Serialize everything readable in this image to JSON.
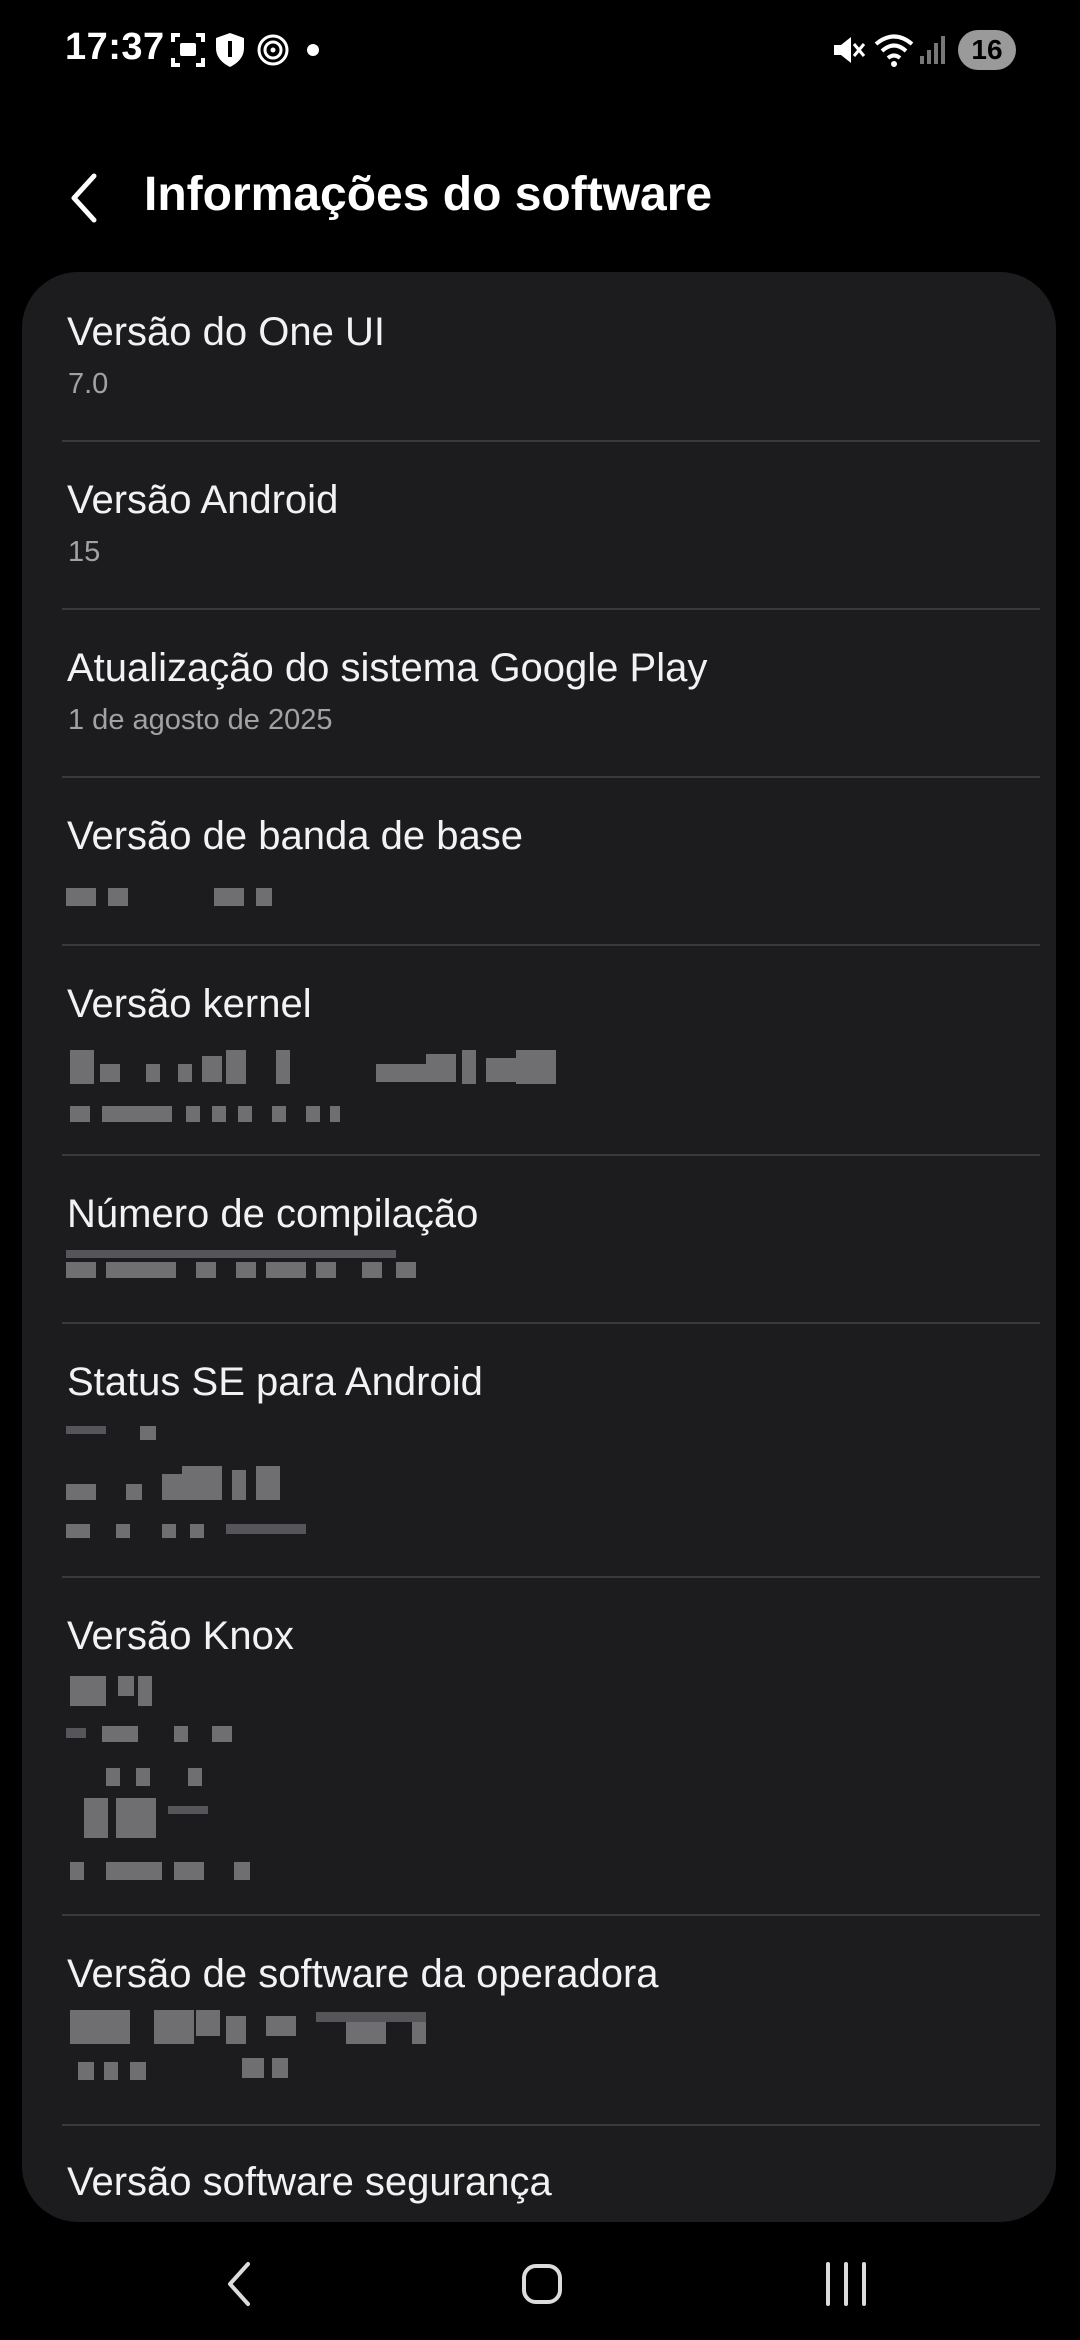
{
  "status_bar": {
    "time": "17:37",
    "left_icons": [
      "screenshot-icon",
      "shield-icon",
      "sync-icon",
      "notification-dot-icon"
    ],
    "right_icons": [
      "mute-icon",
      "wifi-icon",
      "signal-icon"
    ],
    "battery": "16"
  },
  "header": {
    "back_icon": "chevron-left-icon",
    "title": "Informações do software"
  },
  "items": [
    {
      "title": "Versão do One UI",
      "value": "7.0"
    },
    {
      "title": "Versão Android",
      "value": "15"
    },
    {
      "title": "Atualização do sistema Google Play",
      "value": "1 de agosto de 2025"
    },
    {
      "title": "Versão de banda de base",
      "value": ""
    },
    {
      "title": "Versão kernel",
      "value": ""
    },
    {
      "title": "Número de compilação",
      "value": ""
    },
    {
      "title": "Status SE para Android",
      "value": ""
    },
    {
      "title": "Versão Knox",
      "value": ""
    },
    {
      "title": "Versão de software da operadora",
      "value": ""
    },
    {
      "title": "Versão software segurança",
      "value": ""
    }
  ],
  "nav_bar": {
    "icons": [
      "back-icon",
      "home-icon",
      "recents-icon"
    ]
  },
  "colors": {
    "background": "#000000",
    "card": "#1c1c1e",
    "divider": "#3a3a3c",
    "title_text": "#f2f2f2",
    "secondary_text": "#a2a2a2"
  }
}
